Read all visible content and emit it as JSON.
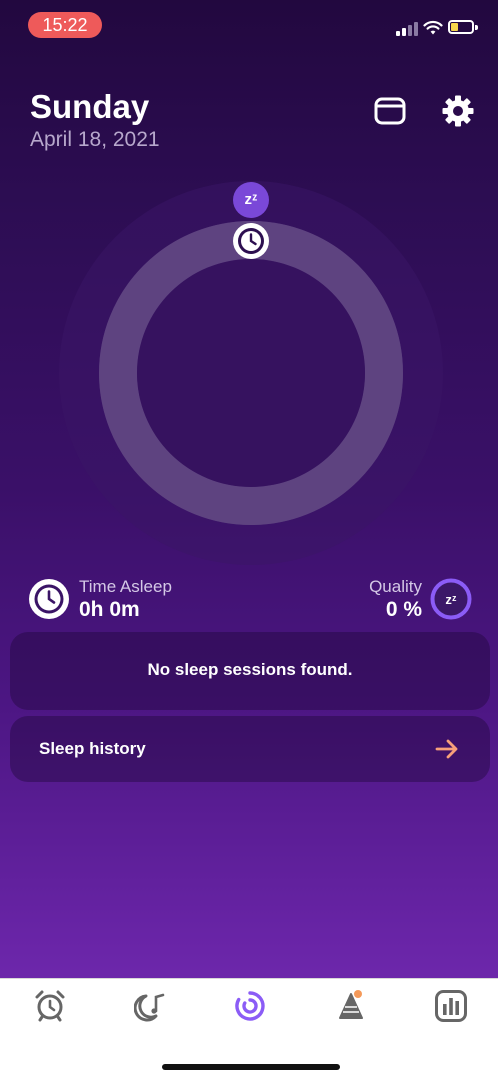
{
  "status_bar": {
    "time": "15:22",
    "signal_icon": "cellular-signal-icon",
    "wifi_icon": "wifi-icon",
    "battery_icon": "battery-low-icon"
  },
  "header": {
    "day": "Sunday",
    "date": "April 18, 2021",
    "calendar_icon": "calendar-icon",
    "settings_icon": "gear-icon"
  },
  "dial": {
    "sleep_marker": "zᶻ",
    "alarm_marker_icon": "clock-icon"
  },
  "stats": {
    "time_asleep": {
      "label": "Time Asleep",
      "value": "0h 0m",
      "icon": "clock-icon"
    },
    "quality": {
      "label": "Quality",
      "value": "0 %",
      "icon": "zz-sleep-icon",
      "percent": 0
    }
  },
  "sessions": {
    "empty_message": "No sleep sessions found."
  },
  "history": {
    "label": "Sleep history",
    "arrow_icon": "arrow-right-icon"
  },
  "tabbar": {
    "tabs": [
      {
        "name": "alarm",
        "icon": "alarm-clock-icon",
        "active": false
      },
      {
        "name": "sleep-sounds",
        "icon": "moon-music-icon",
        "active": false
      },
      {
        "name": "sleep-tracker",
        "icon": "sleep-ring-icon",
        "active": true
      },
      {
        "name": "nap",
        "icon": "nap-cone-icon",
        "active": false,
        "badge": true
      },
      {
        "name": "statistics",
        "icon": "bar-chart-icon",
        "active": false
      }
    ]
  },
  "colors": {
    "accent": "#8b5cf6",
    "status_time_bg": "#ee5a5a",
    "battery": "#f5d64c",
    "arrow": "#f7a07a",
    "badge": "#f59a5a"
  }
}
